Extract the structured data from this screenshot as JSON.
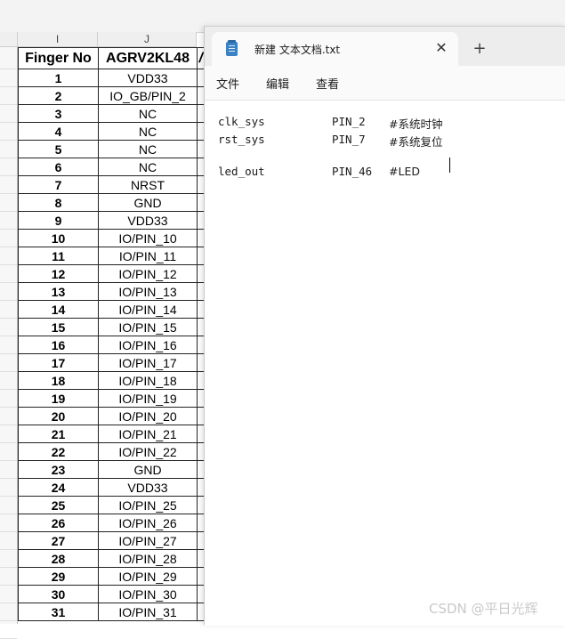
{
  "spreadsheet": {
    "columns": [
      "I",
      "J"
    ],
    "headers": [
      "Finger No",
      "AGRV2KL48"
    ],
    "partial_header": "/",
    "rows": [
      {
        "no": "1",
        "pin": "VDD33"
      },
      {
        "no": "2",
        "pin": "IO_GB/PIN_2"
      },
      {
        "no": "3",
        "pin": "NC"
      },
      {
        "no": "4",
        "pin": "NC"
      },
      {
        "no": "5",
        "pin": "NC"
      },
      {
        "no": "6",
        "pin": "NC"
      },
      {
        "no": "7",
        "pin": "NRST"
      },
      {
        "no": "8",
        "pin": "GND"
      },
      {
        "no": "9",
        "pin": "VDD33"
      },
      {
        "no": "10",
        "pin": "IO/PIN_10"
      },
      {
        "no": "11",
        "pin": "IO/PIN_11"
      },
      {
        "no": "12",
        "pin": "IO/PIN_12"
      },
      {
        "no": "13",
        "pin": "IO/PIN_13"
      },
      {
        "no": "14",
        "pin": "IO/PIN_14"
      },
      {
        "no": "15",
        "pin": "IO/PIN_15"
      },
      {
        "no": "16",
        "pin": "IO/PIN_16"
      },
      {
        "no": "17",
        "pin": "IO/PIN_17"
      },
      {
        "no": "18",
        "pin": "IO/PIN_18"
      },
      {
        "no": "19",
        "pin": "IO/PIN_19"
      },
      {
        "no": "20",
        "pin": "IO/PIN_20"
      },
      {
        "no": "21",
        "pin": "IO/PIN_21"
      },
      {
        "no": "22",
        "pin": "IO/PIN_22"
      },
      {
        "no": "23",
        "pin": "GND"
      },
      {
        "no": "24",
        "pin": "VDD33"
      },
      {
        "no": "25",
        "pin": "IO/PIN_25"
      },
      {
        "no": "26",
        "pin": "IO/PIN_26"
      },
      {
        "no": "27",
        "pin": "IO/PIN_27"
      },
      {
        "no": "28",
        "pin": "IO/PIN_28"
      },
      {
        "no": "29",
        "pin": "IO/PIN_29"
      },
      {
        "no": "30",
        "pin": "IO/PIN_30"
      },
      {
        "no": "31",
        "pin": "IO/PIN_31"
      }
    ]
  },
  "notepad": {
    "tab_title": "新建 文本文档.txt",
    "close_glyph": "✕",
    "new_tab_glyph": "+",
    "menu": [
      "文件",
      "编辑",
      "查看"
    ],
    "lines": [
      {
        "name": "clk_sys",
        "pin": "PIN_2",
        "comment": "#系统时钟"
      },
      {
        "name": "rst_sys",
        "pin": "PIN_7",
        "comment": "#系统复位"
      },
      {
        "name": "led_out",
        "pin": "PIN_46",
        "comment": "#LED"
      }
    ]
  },
  "watermark": "CSDN @平日光辉",
  "colors": {
    "notepad_icon": "#3b82c4",
    "grid_border": "#222222",
    "watermark": "#c9c9c9"
  },
  "icons": {
    "app": "notepad-icon",
    "close": "close-icon",
    "new_tab": "plus-icon"
  }
}
